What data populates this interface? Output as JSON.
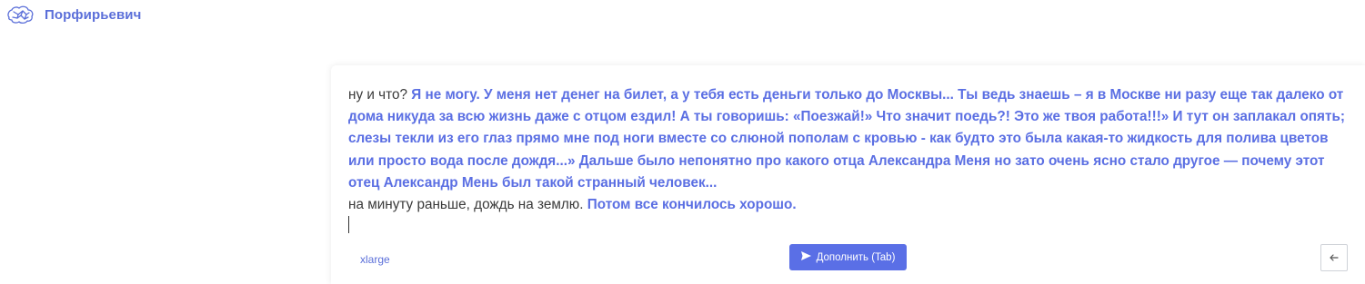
{
  "header": {
    "logo_icon": "brain-icon",
    "title": "Порфирьевич"
  },
  "editor": {
    "para1_user": "ну и что? ",
    "para1_generated": "Я не могу. У меня нет денег на билет, а у тебя есть деньги только до Москвы... Ты ведь знаешь – я в Москве ни разу еще так далеко от дома никуда за всю жизнь даже с отцом ездил! А ты говоришь: «Поезжай!» Что значит поедь?! Это же твоя работа!!!» И тут он заплакал опять; слезы текли из его глаз прямо мне под ноги вместе со слюной пополам с кровью - как будто это была какая-то жидкость для полива цветов или просто вода после дождя...» Дальше было непонятно про какого отца Александра Меня но зато очень ясно стало другое — почему этот отец Александр Мень был такой странный человек...",
    "para2_user": "на минуту раньше, дождь на землю. ",
    "para2_generated": "Потом все кончилось хорошо."
  },
  "footer": {
    "model_label": "xlarge",
    "complete_button_label": "Дополнить (Tab)",
    "complete_button_icon": "send-icon",
    "back_button_icon": "arrow-left-icon"
  },
  "colors": {
    "accent": "#5a6fe6",
    "generated_text": "#5b6fe3",
    "user_text": "#3a3a3a"
  }
}
